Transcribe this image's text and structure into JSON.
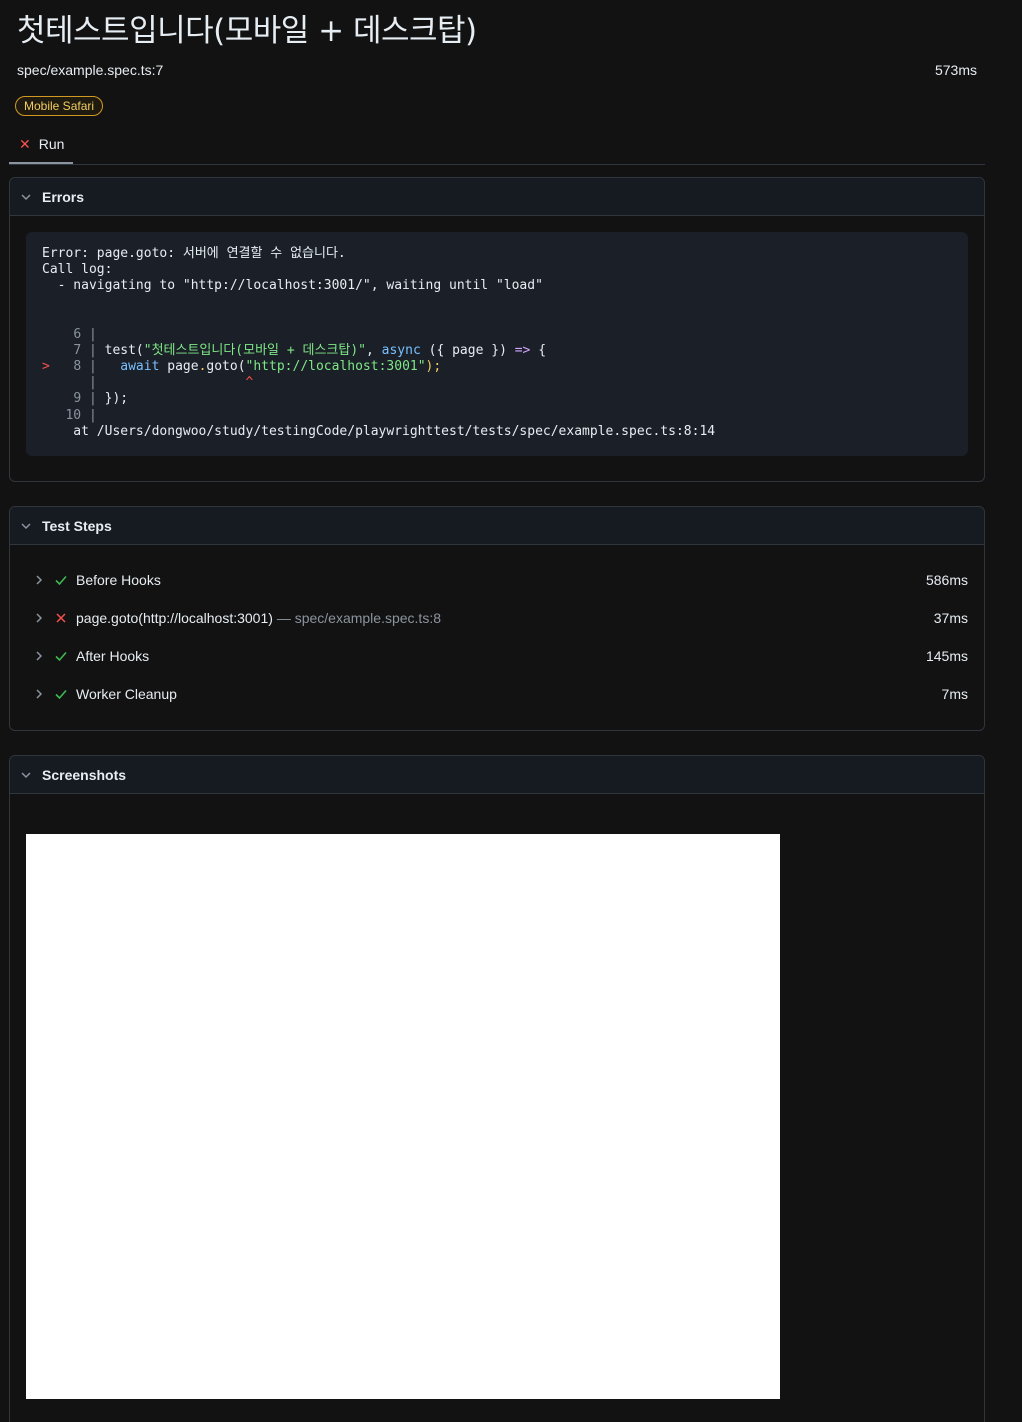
{
  "header": {
    "title": "첫테스트입니다(모바일 + 데스크탑)",
    "location": "spec/example.spec.ts:7",
    "duration": "573ms",
    "project_badge": "Mobile Safari"
  },
  "tabs": [
    {
      "label": "Run",
      "status": "failed"
    }
  ],
  "errors": {
    "header": "Errors",
    "lines": {
      "l1": "Error: page.goto: 서버에 연결할 수 없습니다.",
      "l2": "Call log:",
      "l3": "  - navigating to \"http://localhost:3001/\", waiting until \"load\"",
      "at": "    at /Users/dongwoo/study/testingCode/playwrighttest/tests/spec/example.spec.ts:8:14"
    },
    "code": {
      "n6": "6",
      "n7": "7",
      "n8": "8",
      "n9": "9",
      "n10": "10",
      "test_call": "test(",
      "test_name": "\"첫테스트입니다(모바일 + 데스크탑)\"",
      "comma": ", ",
      "async_kw": "async",
      "params": " ({ page }) ",
      "arrow": "=>",
      "open_brace": " {",
      "await_kw": "await",
      "goto_obj": " page",
      "goto_dot": ".",
      "goto_fn": "goto(",
      "goto_url": "\"http://localhost:3001\"",
      "goto_end": ");",
      "close": "});"
    }
  },
  "steps": {
    "header": "Test Steps",
    "items": [
      {
        "label": "Before Hooks",
        "location": "",
        "time": "586ms",
        "status": "passed"
      },
      {
        "label": "page.goto(http://localhost:3001)",
        "location": "— spec/example.spec.ts:8",
        "time": "37ms",
        "status": "failed"
      },
      {
        "label": "After Hooks",
        "location": "",
        "time": "145ms",
        "status": "passed"
      },
      {
        "label": "Worker Cleanup",
        "location": "",
        "time": "7ms",
        "status": "passed"
      }
    ]
  },
  "screenshots": {
    "header": "Screenshots"
  },
  "colors": {
    "background": "#121212",
    "passed": "#3fb950",
    "failed": "#f85149",
    "badge": "#d29922"
  }
}
